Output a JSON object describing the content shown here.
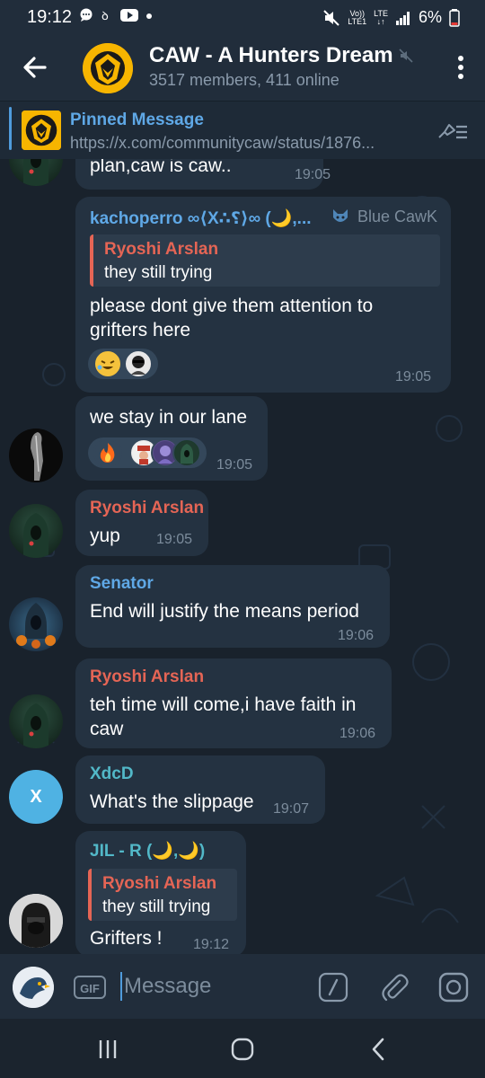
{
  "status_bar": {
    "time": "19:12",
    "volte_top": "Vo))",
    "volte_bottom": "LTE1",
    "lte_top": "LTE",
    "lte_bottom": "↓↑",
    "battery": "6%"
  },
  "header": {
    "title": "CAW - A Hunters Dream",
    "subtitle": "3517 members, 411 online",
    "avatar_icon": "lion-logo-icon"
  },
  "pinned": {
    "title": "Pinned Message",
    "text": "https://x.com/communitycaw/status/1876..."
  },
  "messages": [
    {
      "text": "plan,caw is caw..",
      "time": "19:05"
    },
    {
      "sender": "kachoperro ∞⟨X∴⸮⟩∞ (🌙,...",
      "badge": "Blue CawK",
      "reply_name": "Ryoshi Arslan",
      "reply_text": "they still trying",
      "text": "please dont give them attention to grifters here",
      "time": "19:05"
    },
    {
      "text": "we stay in our lane",
      "time": "19:05"
    },
    {
      "sender": "Ryoshi Arslan",
      "text": "yup",
      "time": "19:05"
    },
    {
      "sender": "Senator",
      "text": "End will justify the means period",
      "time": "19:06"
    },
    {
      "sender": "Ryoshi Arslan",
      "text": "teh time will come,i have faith in caw",
      "time": "19:06"
    },
    {
      "sender": "XdcD",
      "avatar_letter": "X",
      "text": "What's the slippage",
      "time": "19:07"
    },
    {
      "sender": "JIL - R (🌙,🌙)",
      "reply_name": "Ryoshi Arslan",
      "reply_text": "they still trying",
      "text": "Grifters !",
      "time": "19:12"
    }
  ],
  "input": {
    "placeholder": "Message",
    "gif_label": "GIF"
  },
  "colors": {
    "accent": "#4f9bdc",
    "bubble": "#243241",
    "name_blue": "#5fa8e6",
    "name_red": "#e56555",
    "name_teal": "#52b8c8"
  }
}
